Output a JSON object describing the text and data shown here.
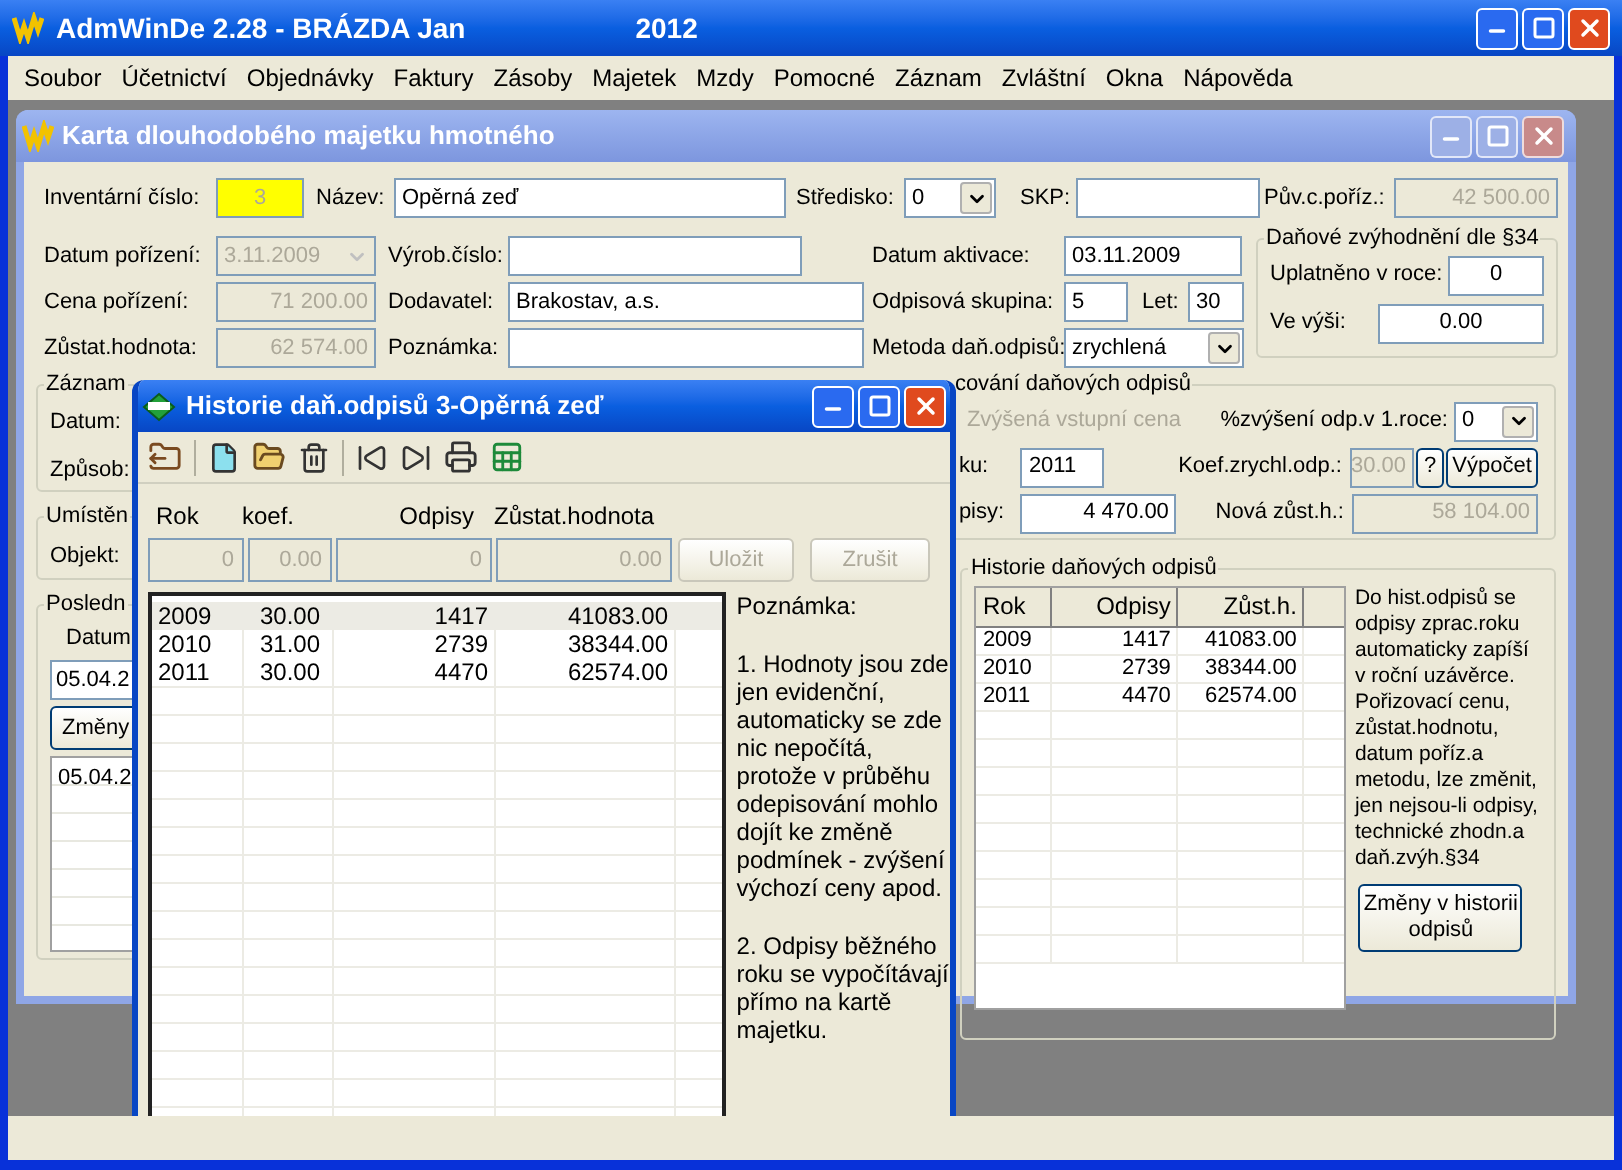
{
  "app": {
    "title": "AdmWinDe 2.28 - BRÁZDA Jan",
    "year": "2012"
  },
  "menu": [
    "Soubor",
    "Účetnictví",
    "Objednávky",
    "Faktury",
    "Zásoby",
    "Majetek",
    "Mzdy",
    "Pomocné",
    "Záznam",
    "Zvláštní",
    "Okna",
    "Nápověda"
  ],
  "card": {
    "title": "Karta dlouhodobého majetku hmotného",
    "inventory_number": {
      "label": "Inventární číslo:",
      "value": "3"
    },
    "name": {
      "label": "Název:",
      "value": "Opěrná zeď"
    },
    "cost_center": {
      "label": "Středisko:",
      "value": "0"
    },
    "skp": {
      "label": "SKP:"
    },
    "original_price": {
      "label": "Pův.c.poříz.:",
      "value": "42 500.00",
      "disabled": true
    },
    "acquisition_date": {
      "label": "Datum pořízení:",
      "value": "3.11.2009",
      "disabled": true
    },
    "serial_number": {
      "label": "Výrob.číslo:"
    },
    "activation_date": {
      "label": "Datum aktivace:",
      "value": "03.11.2009"
    },
    "acquisition_price": {
      "label": "Cena pořízení:",
      "value": "71 200.00",
      "disabled": true
    },
    "supplier": {
      "label": "Dodavatel:",
      "value": "Brakostav, a.s."
    },
    "depreciation_group": {
      "label": "Odpisová skupina:",
      "value": "5"
    },
    "years": {
      "label": "Let:",
      "value": "30"
    },
    "residual_value": {
      "label": "Zůstat.hodnota:",
      "value": "62 574.00",
      "disabled": true
    },
    "note": {
      "label": "Poznámka:"
    },
    "tax_method": {
      "label": "Metoda daň.odpisů:",
      "value": "zrychlená"
    },
    "tax_relief": {
      "legend": "Daňové zvýhodnění dle §34",
      "applied_year": {
        "label": "Uplatněno v roce:",
        "value": "0"
      },
      "amount": {
        "label": "Ve výši:",
        "value": "0.00"
      }
    },
    "record_group": {
      "legend": "Záznam",
      "labels": [
        "Datum:",
        "Způsob:"
      ]
    },
    "location_group": {
      "legend": "Umístěn",
      "labels": [
        "Objekt:"
      ]
    },
    "last_group": {
      "legend": "Posledn",
      "column": "Datum",
      "date_field": "05.04.2",
      "button": "Změny",
      "list": [
        "05.04.2"
      ]
    },
    "tax_group": {
      "legend": "cování daňových odpisů",
      "increased_price": {
        "label": "Zvýšená vstupní cena",
        "disabled": true
      },
      "increase_pct": {
        "label": "%zvýšení odp.v 1.roce:",
        "value": "0"
      },
      "year": {
        "label": "ku:",
        "value": "2011"
      },
      "coef": {
        "label": "Koef.zrychl.odp.:",
        "value": "30.00",
        "disabled": true
      },
      "help_button": "?",
      "calc_button": "Výpočet",
      "depreciation": {
        "label": "pisy:",
        "value": "4 470.00"
      },
      "new_residual": {
        "label": "Nová zůst.h.:",
        "value": "58 104.00",
        "disabled": true
      }
    },
    "history": {
      "legend": "Historie daňových odpisů",
      "columns": [
        "Rok",
        "Odpisy",
        "Zůst.h."
      ],
      "rows": [
        [
          "2009",
          "1417",
          "41083.00"
        ],
        [
          "2010",
          "2739",
          "38344.00"
        ],
        [
          "2011",
          "4470",
          "62574.00"
        ]
      ],
      "note": "Do hist.odpisů se odpisy zprac.roku automaticky zapíší v roční uzávěrce. Pořizovací cenu, zůstat.hodnotu, datum poříz.a metodu, lze změnit, jen nejsou-li odpisy, technické zhodn.a daň.zvýh.§34",
      "button": "Změny v historii odpisů"
    }
  },
  "dialog": {
    "title": "Historie daň.odpisů 3-Opěrná zeď",
    "columns": [
      "Rok",
      "koef.",
      "Odpisy",
      "Zůstat.hodnota"
    ],
    "edit": {
      "values": [
        "0",
        "0.00",
        "0",
        "0.00"
      ],
      "disabled": true
    },
    "buttons": [
      {
        "label": "Uložit",
        "disabled": true
      },
      {
        "label": "Zrušit",
        "disabled": true
      }
    ],
    "rows": [
      {
        "cells": [
          "2009",
          "30.00",
          "1417",
          "41083.00"
        ],
        "selected": true
      },
      {
        "cells": [
          "2010",
          "31.00",
          "2739",
          "38344.00"
        ],
        "selected": false
      },
      {
        "cells": [
          "2011",
          "30.00",
          "4470",
          "62574.00"
        ],
        "selected": false
      }
    ],
    "note": [
      "Poznámka:",
      "1. Hodnoty jsou zde jen evidenční, automaticky se zde nic nepočítá, protože v průběhu odepisování mohlo dojít ke změně podmínek - zvýšení výchozí ceny apod.",
      "2. Odpisy běžného roku se vypočítávají přímo na kartě majetku."
    ]
  }
}
